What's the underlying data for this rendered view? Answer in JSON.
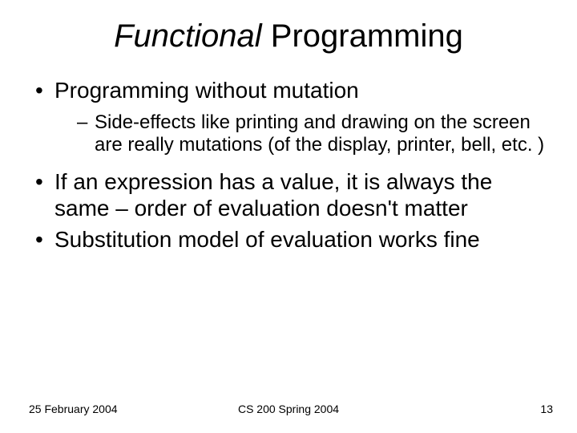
{
  "title": {
    "italic": "Functional",
    "rest": " Programming"
  },
  "bullets": {
    "b1": "Programming without mutation",
    "b1_sub1": "Side-effects like printing and drawing on the screen are really mutations (of the display, printer, bell, etc. )",
    "b2": "If an expression has a value, it is always the same – order of evaluation doesn't matter",
    "b3": "Substitution model of evaluation works fine"
  },
  "footer": {
    "date": "25 February 2004",
    "course": "CS 200 Spring 2004",
    "page": "13"
  }
}
